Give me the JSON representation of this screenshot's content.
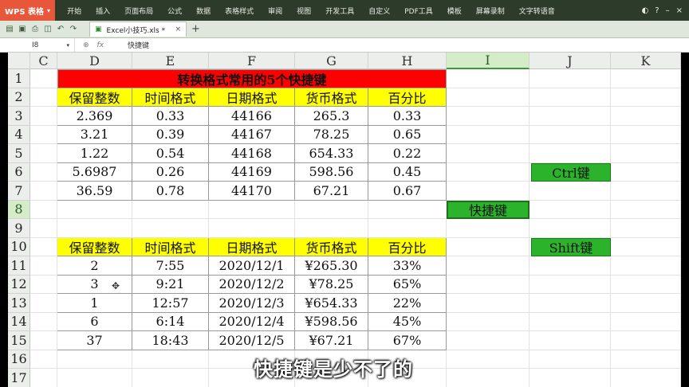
{
  "app": {
    "brand": "WPS 表格",
    "menu": [
      "开始",
      "插入",
      "页面布局",
      "公式",
      "数据",
      "表格样式",
      "审阅",
      "视图",
      "开发工具",
      "自定义",
      "PDF工具",
      "模板",
      "屏幕录制",
      "文字转语音"
    ]
  },
  "tab": {
    "name": "Excel小技巧.xls *"
  },
  "formula": {
    "cell_ref": "I8",
    "fx": "fx",
    "content": "快捷键"
  },
  "columns": [
    "C",
    "D",
    "E",
    "F",
    "G",
    "H",
    "I",
    "J",
    "K"
  ],
  "rows": [
    "1",
    "2",
    "3",
    "4",
    "5",
    "6",
    "7",
    "8",
    "9",
    "10",
    "11",
    "12",
    "13",
    "14",
    "15",
    "16",
    "17"
  ],
  "table1": {
    "title": "转换格式常用的5个快捷键",
    "headers": [
      "保留整数",
      "时间格式",
      "日期格式",
      "货币格式",
      "百分比"
    ],
    "rows": [
      [
        "2.369",
        "0.33",
        "44166",
        "265.3",
        "0.33"
      ],
      [
        "3.21",
        "0.39",
        "44167",
        "78.25",
        "0.65"
      ],
      [
        "1.22",
        "0.54",
        "44168",
        "654.33",
        "0.22"
      ],
      [
        "5.6987",
        "0.26",
        "44169",
        "598.56",
        "0.45"
      ],
      [
        "36.59",
        "0.78",
        "44170",
        "67.21",
        "0.67"
      ]
    ]
  },
  "table2": {
    "headers": [
      "保留整数",
      "时间格式",
      "日期格式",
      "货币格式",
      "百分比"
    ],
    "rows": [
      [
        "2",
        "7:55",
        "2020/12/1",
        "¥265.30",
        "33%"
      ],
      [
        "3",
        "9:21",
        "2020/12/2",
        "¥78.25",
        "65%"
      ],
      [
        "1",
        "12:57",
        "2020/12/3",
        "¥654.33",
        "22%"
      ],
      [
        "6",
        "6:14",
        "2020/12/4",
        "¥598.56",
        "45%"
      ],
      [
        "37",
        "18:43",
        "2020/12/5",
        "¥67.21",
        "67%"
      ]
    ]
  },
  "buttons": {
    "ctrl": "Ctrl键",
    "shortcut": "快捷键",
    "shift": "Shift键"
  },
  "subtitle": "快捷键是少不了的",
  "colors": {
    "title_fill": "#ff0000",
    "header_fill": "#ffff00",
    "button_fill": "#2bb32b"
  }
}
